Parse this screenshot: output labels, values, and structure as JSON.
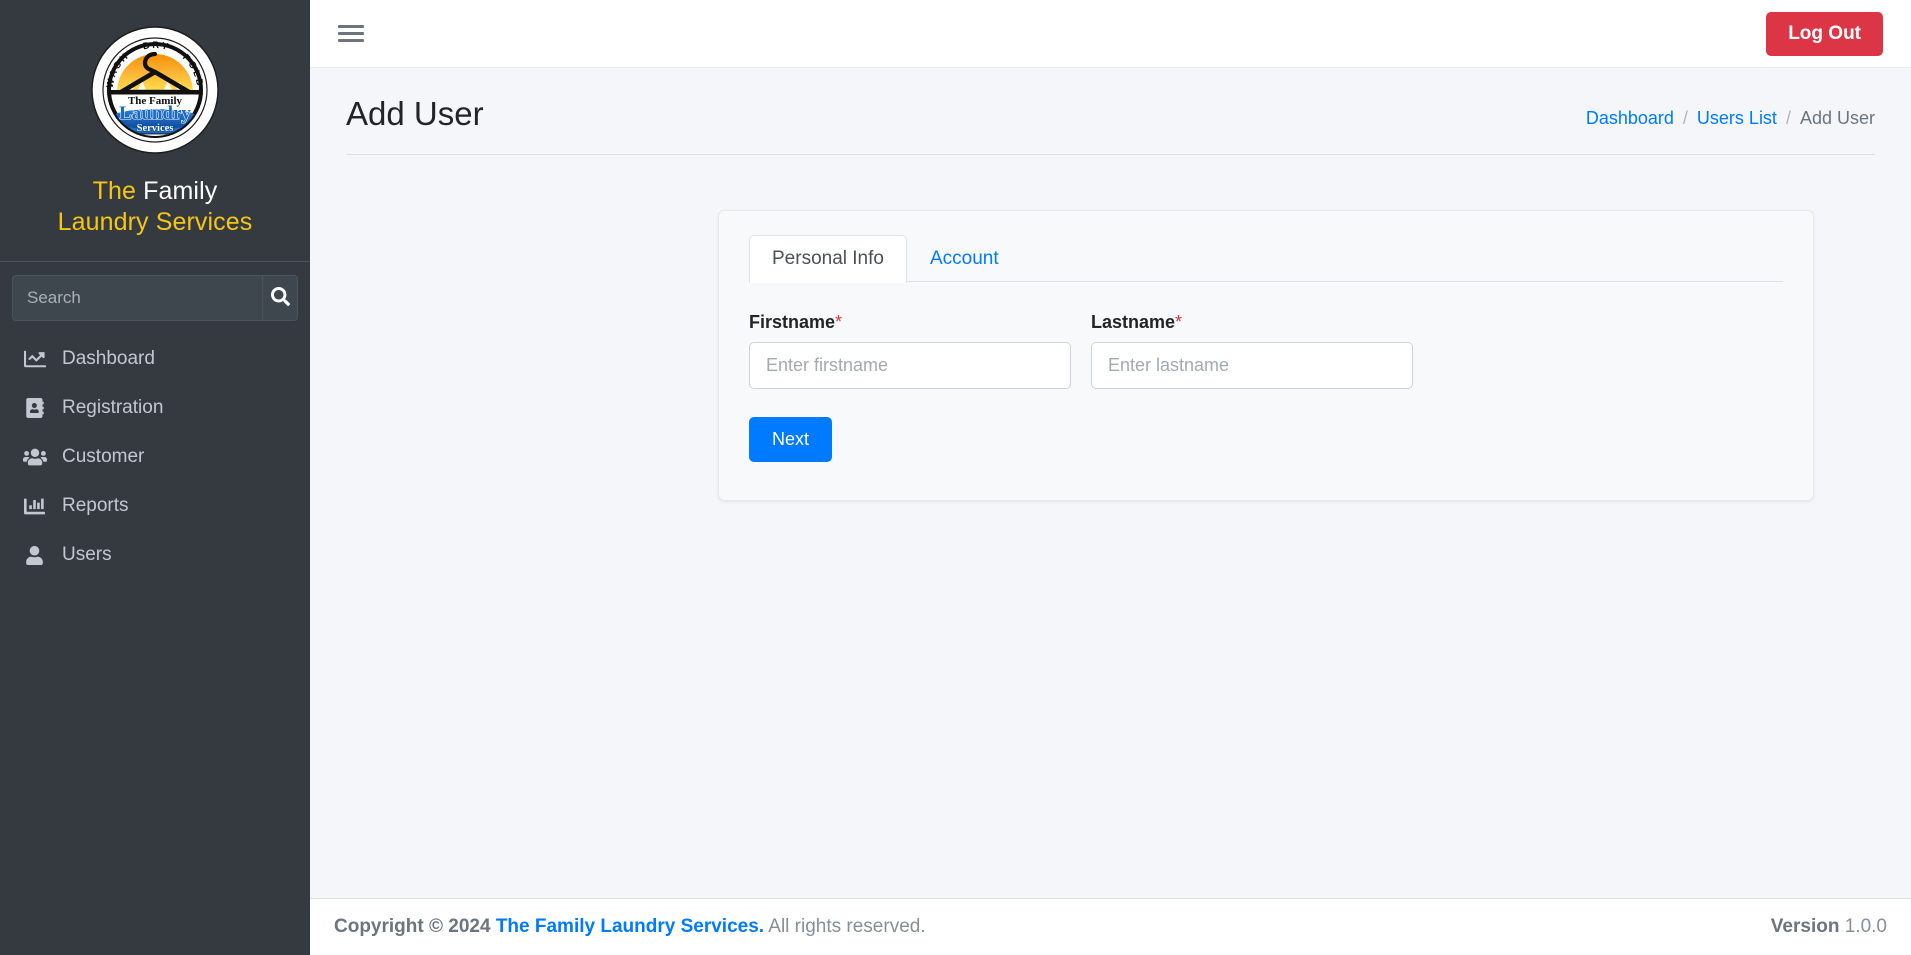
{
  "sidebar": {
    "logo": {
      "icon": "laundry-badge-logo",
      "ring_text": "WASH · DRY · FOLD",
      "center_line1": "The Family",
      "center_line2": "Laundry",
      "center_line3": "Services"
    },
    "brand": {
      "line1_a": "The ",
      "line1_b": "Family",
      "line2": "Laundry Services"
    },
    "search": {
      "placeholder": "Search",
      "value": "",
      "button_icon": "search-icon"
    },
    "items": [
      {
        "label": "Dashboard",
        "icon": "chart-line-icon"
      },
      {
        "label": "Registration",
        "icon": "address-book-icon"
      },
      {
        "label": "Customer",
        "icon": "users-group-icon"
      },
      {
        "label": "Reports",
        "icon": "chart-bar-icon"
      },
      {
        "label": "Users",
        "icon": "user-icon"
      }
    ]
  },
  "topbar": {
    "menu_icon": "hamburger-menu-icon",
    "logout_label": "Log Out"
  },
  "page": {
    "title": "Add User",
    "breadcrumb": [
      {
        "label": "Dashboard",
        "link": true
      },
      {
        "label": "Users List",
        "link": true
      },
      {
        "label": "Add User",
        "link": false
      }
    ],
    "breadcrumb_separator": "/"
  },
  "card": {
    "tabs": [
      {
        "label": "Personal Info",
        "active": true
      },
      {
        "label": "Account",
        "active": false
      }
    ],
    "fields": [
      {
        "label": "Firstname",
        "required_mark": "*",
        "placeholder": "Enter firstname",
        "value": ""
      },
      {
        "label": "Lastname",
        "required_mark": "*",
        "placeholder": "Enter lastname",
        "value": ""
      }
    ],
    "next_label": "Next"
  },
  "footer": {
    "copyright_prefix": "Copyright © 2024",
    "company": "The Family Laundry Services.",
    "rights": " All rights reserved.",
    "version_label": "Version",
    "version_value": "1.0.0"
  },
  "colors": {
    "sidebar_bg": "#343a40",
    "content_bg": "#f4f6f9",
    "accent_blue": "#007bff",
    "danger_red": "#dc3545",
    "brand_yellow": "#f5c518",
    "muted_text": "#6c757d"
  }
}
